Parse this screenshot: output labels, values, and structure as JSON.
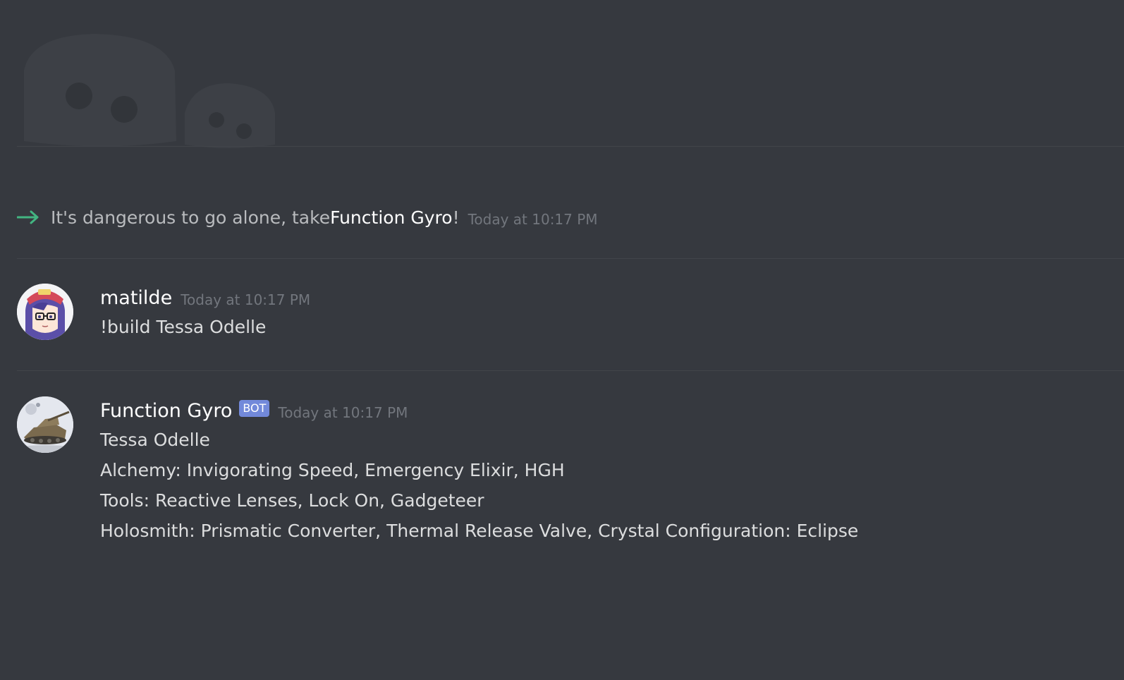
{
  "colors": {
    "background": "#36393f",
    "divider": "#42454a",
    "join_arrow": "#43b581",
    "timestamp": "#72767d",
    "bot_badge": "#7289da",
    "username": "#ffffff",
    "body_text": "#dcddde"
  },
  "join_message": {
    "icon": "arrow-right-icon",
    "text_before": "It's dangerous to go alone, take ",
    "user_name": "Function Gyro",
    "text_after": "!",
    "timestamp": "Today at 10:17 PM"
  },
  "messages": [
    {
      "avatar": "anime-girl-avatar",
      "username": "matilde",
      "timestamp": "Today at 10:17 PM",
      "lines": [
        "!build Tessa Odelle"
      ]
    },
    {
      "avatar": "tank-avatar",
      "username": "Function Gyro",
      "badge": "BOT",
      "timestamp": "Today at 10:17 PM",
      "lines": [
        "Tessa Odelle",
        "Alchemy: Invigorating Speed, Emergency Elixir, HGH",
        "Tools: Reactive Lenses, Lock On, Gadgeteer",
        "Holosmith: Prismatic Converter, Thermal Release Valve, Crystal Configuration: Eclipse"
      ]
    }
  ]
}
